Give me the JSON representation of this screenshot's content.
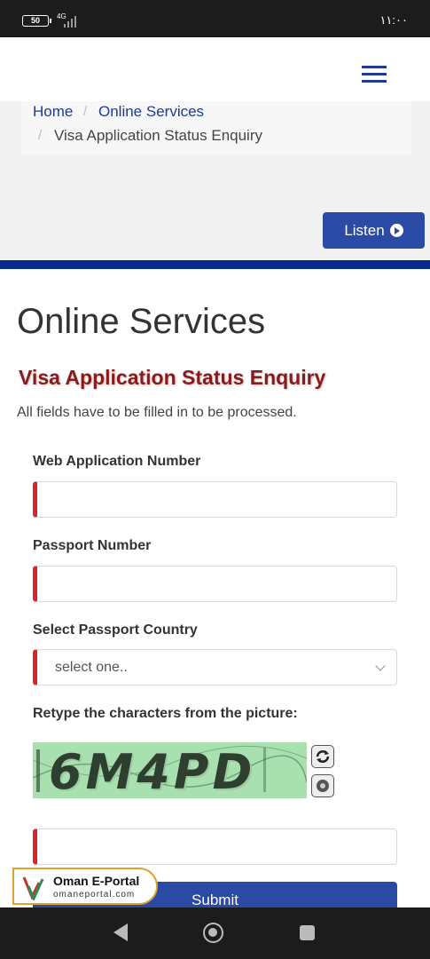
{
  "status_bar": {
    "battery": "50",
    "network": "4G",
    "time": "١١:٠٠"
  },
  "breadcrumb": {
    "home": "Home",
    "online_services": "Online Services",
    "current": "Visa Application Status Enquiry"
  },
  "listen_button": {
    "label": "Listen"
  },
  "page": {
    "title": "Online Services",
    "section_title": "Visa Application Status Enquiry",
    "info": "All fields have to be filled in to be processed."
  },
  "form": {
    "web_app_label": "Web Application Number",
    "web_app_value": "",
    "passport_label": "Passport Number",
    "passport_value": "",
    "country_label": "Select Passport Country",
    "country_selected": "select one..",
    "captcha_label": "Retype the characters from the picture:",
    "captcha_text": "6M4PD",
    "captcha_value": "",
    "submit_label": "Submit"
  },
  "watermark": {
    "title": "Oman E-Portal",
    "url": "omaneportal.com"
  },
  "colors": {
    "primary": "#2a4aa6",
    "navy_bar": "#0a2a8c",
    "section_title": "#8b1a1a",
    "required_marker": "#d7262b"
  }
}
